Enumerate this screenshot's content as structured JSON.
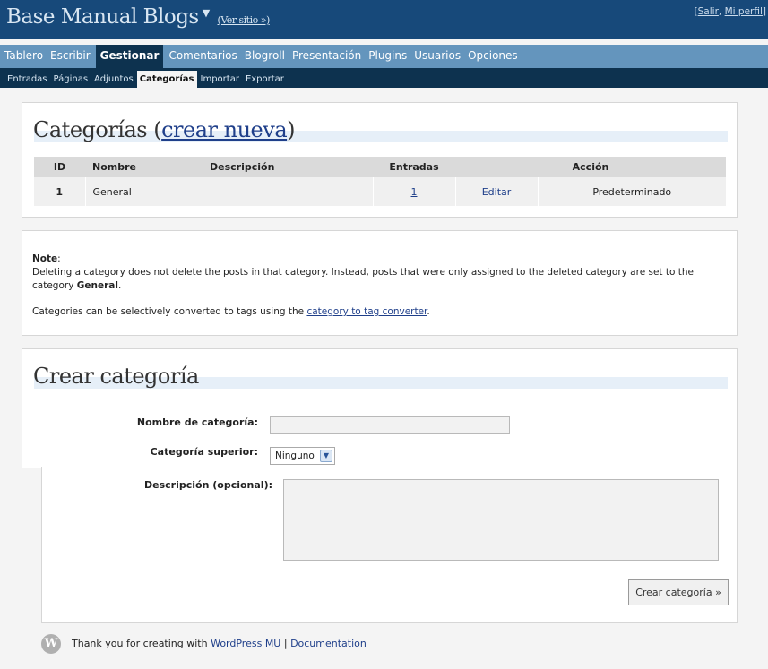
{
  "header": {
    "blog_title": "Base Manual Blogs",
    "view_site": "(Ver sitio »)",
    "logout": "Salir",
    "profile": "Mi perfil"
  },
  "nav": {
    "items": [
      "Tablero",
      "Escribir",
      "Gestionar",
      "Comentarios",
      "Blogroll",
      "Presentación",
      "Plugins",
      "Usuarios",
      "Opciones"
    ],
    "current": "Gestionar"
  },
  "subnav": {
    "items": [
      "Entradas",
      "Páginas",
      "Adjuntos",
      "Categorías",
      "Importar",
      "Exportar"
    ],
    "current": "Categorías"
  },
  "categories": {
    "heading": "Categorías (",
    "create_link": "crear nueva",
    "heading_close": ")",
    "columns": [
      "ID",
      "Nombre",
      "Descripción",
      "Entradas",
      "Acción"
    ],
    "rows": [
      {
        "id": "1",
        "name": "General",
        "description": "",
        "posts": "1",
        "edit": "Editar",
        "default": "Predeterminado"
      }
    ]
  },
  "note": {
    "label": "Note",
    "line1": "Deleting a category does not delete the posts in that category. Instead, posts that were only assigned to the deleted category are set to the category ",
    "line1_bold": "General",
    "line2_prefix": "Categories can be selectively converted to tags using the ",
    "line2_link": "category to tag converter"
  },
  "create_form": {
    "heading": "Crear categoría",
    "name_label": "Nombre de categoría:",
    "name_value": "",
    "parent_label": "Categoría superior:",
    "parent_value": "Ninguno",
    "desc_label": "Descripción (opcional):",
    "desc_value": "",
    "submit_label": "Crear categoría »"
  },
  "footer": {
    "logo_letter": "W",
    "text": "Thank you for creating with ",
    "wp_link": "WordPress MU",
    "separator": " | ",
    "doc_link": "Documentation"
  }
}
